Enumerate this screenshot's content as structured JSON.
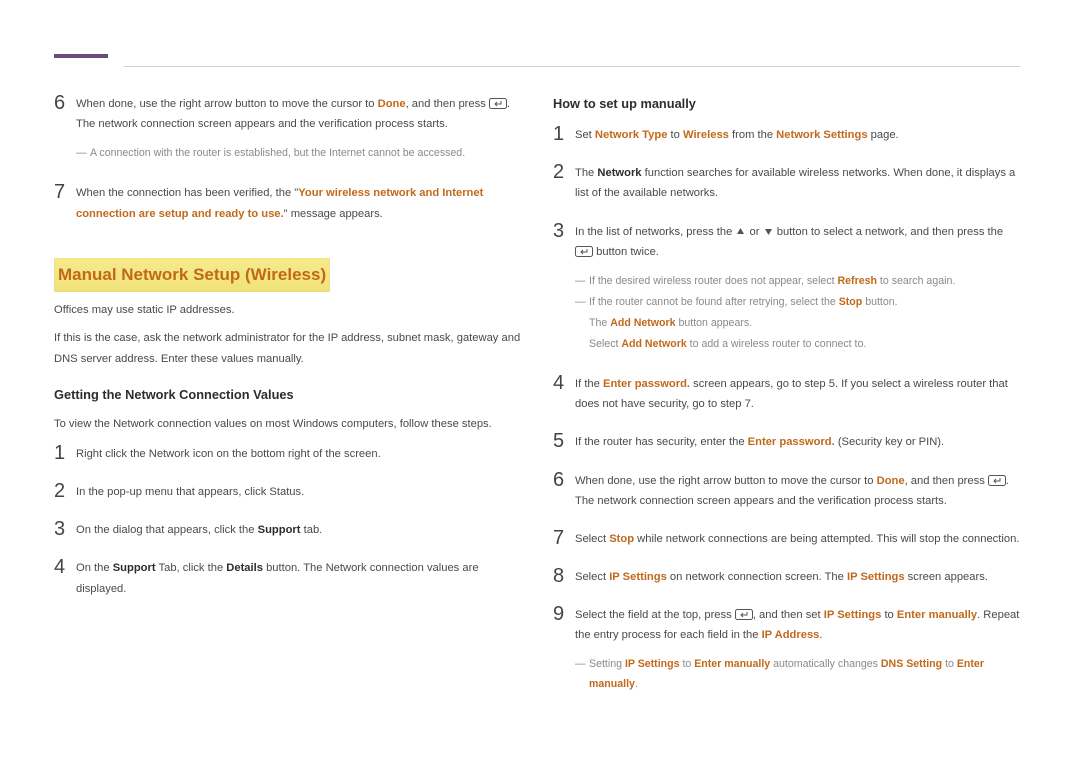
{
  "left": {
    "step6": {
      "pre": "When done, use the right arrow button to move the cursor to ",
      "done": "Done",
      "mid": ", and then press ",
      "post": ". The network connection screen appears and the verification process starts."
    },
    "step6_note": "A connection with the router is established, but the Internet cannot be accessed.",
    "step7": {
      "pre": "When the connection has been verified, the \"",
      "msg": "Your wireless network and Internet connection are setup and ready to use.",
      "post": "\" message appears."
    },
    "section_title": "Manual Network Setup (Wireless)",
    "intro1": "Offices may use static IP addresses.",
    "intro2": "If this is the case, ask the network administrator for the IP address, subnet mask, gateway and DNS server address. Enter these values manually.",
    "sub_h": "Getting the Network Connection Values",
    "intro3": "To view the Network connection values on most Windows computers, follow these steps.",
    "g1": "Right click the Network icon on the bottom right of the screen.",
    "g2": "In the pop-up menu that appears, click Status.",
    "g3_pre": "On the dialog that appears, click the ",
    "g3_b": "Support",
    "g3_post": " tab.",
    "g4_pre": "On the ",
    "g4_b1": "Support",
    "g4_mid": " Tab, click the ",
    "g4_b2": "Details",
    "g4_post": " button. The Network connection values are displayed."
  },
  "right": {
    "sub_h": "How to set up manually",
    "s1": {
      "pre": "Set ",
      "a": "Network Type",
      "mid1": " to ",
      "b": "Wireless",
      "mid2": " from the ",
      "c": "Network Settings",
      "post": " page."
    },
    "s2": {
      "pre": "The ",
      "a": "Network",
      "post": " function searches for available wireless networks. When done, it displays a list of the available networks."
    },
    "s3": {
      "pre": "In the list of networks, press the ",
      "mid": " or ",
      "mid2": " button to select a network, and then press the ",
      "post": " button twice."
    },
    "s3_n1_pre": "If the desired wireless router does not appear, select ",
    "s3_n1_b": "Refresh",
    "s3_n1_post": " to search again.",
    "s3_n2_pre": "If the router cannot be found after retrying, select the ",
    "s3_n2_b": "Stop",
    "s3_n2_post": " button.",
    "s3_n3_pre": "The ",
    "s3_n3_b": "Add Network",
    "s3_n3_post": " button appears.",
    "s3_n4_pre": "Select ",
    "s3_n4_b": "Add Network",
    "s3_n4_post": " to add a wireless router to connect to.",
    "s4_pre": "If the ",
    "s4_b": "Enter password.",
    "s4_post": " screen appears, go to step 5. If you select a wireless router that does not have security, go to step 7.",
    "s5_pre": "If the router has security, enter the ",
    "s5_b": "Enter password.",
    "s5_post": " (Security key or PIN).",
    "s6_pre": "When done, use the right arrow button to move the cursor to ",
    "s6_b": "Done",
    "s6_mid": ", and then press ",
    "s6_post": ". The network connection screen appears and the verification process starts.",
    "s7_pre": "Select ",
    "s7_b": "Stop",
    "s7_post": " while network connections are being attempted. This will stop the connection.",
    "s8_pre": "Select ",
    "s8_b1": "IP Settings",
    "s8_mid": " on network connection screen. The ",
    "s8_b2": "IP Settings",
    "s8_post": " screen appears.",
    "s9_pre": "Select the field at the top, press ",
    "s9_mid": ", and then set ",
    "s9_b1": "IP Settings",
    "s9_mid2": " to ",
    "s9_b2": "Enter manually",
    "s9_mid3": ". Repeat the entry process for each field in the ",
    "s9_b3": "IP Address",
    "s9_post": ".",
    "s9_n_pre": "Setting ",
    "s9_n_b1": "IP Settings",
    "s9_n_mid1": " to ",
    "s9_n_b2": "Enter manually",
    "s9_n_mid2": " automatically changes ",
    "s9_n_b3": "DNS Setting",
    "s9_n_mid3": " to ",
    "s9_n_b4": "Enter manually",
    "s9_n_post": "."
  },
  "nums": {
    "n1": "1",
    "n2": "2",
    "n3": "3",
    "n4": "4",
    "n5": "5",
    "n6": "6",
    "n7": "7",
    "n8": "8",
    "n9": "9"
  }
}
